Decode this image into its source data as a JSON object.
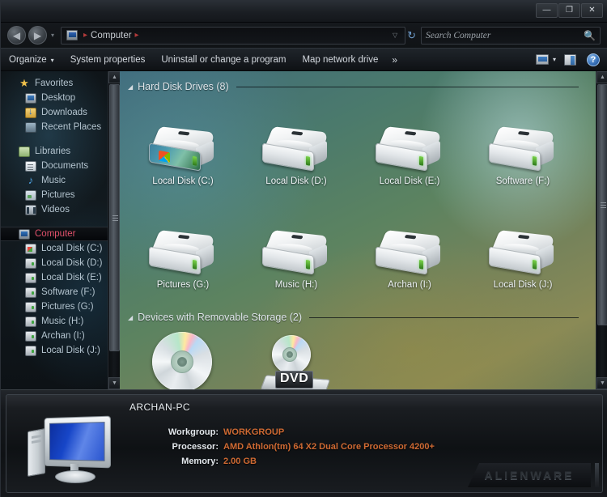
{
  "window": {
    "minimize_label": "—",
    "restore_label": "❐",
    "close_label": "✕"
  },
  "address_bar": {
    "back_label": "◀",
    "forward_label": "▶",
    "history_caret": "▾",
    "crumb_text": "Computer",
    "crumb_sep": "▸",
    "dropdown_caret": "▽",
    "refresh_label": "↻"
  },
  "search": {
    "placeholder": "Search Computer",
    "value": "",
    "icon_label": "🔍"
  },
  "command_bar": {
    "items": [
      {
        "label": "Organize",
        "caret": "▾"
      },
      {
        "label": "System properties",
        "caret": ""
      },
      {
        "label": "Uninstall or change a program",
        "caret": ""
      },
      {
        "label": "Map network drive",
        "caret": ""
      }
    ],
    "overflow_label": "»",
    "view_caret": "▾",
    "help_label": "?"
  },
  "sidebar": {
    "groups": [
      {
        "header": {
          "label": "Favorites",
          "icon": "star-icon",
          "icon_class": "ic-star",
          "glyph": "★"
        },
        "items": [
          {
            "label": "Desktop",
            "icon": "desktop-icon",
            "icon_class": "ic-desktop"
          },
          {
            "label": "Downloads",
            "icon": "downloads-icon",
            "icon_class": "ic-download"
          },
          {
            "label": "Recent Places",
            "icon": "recent-places-icon",
            "icon_class": "ic-recent"
          }
        ]
      },
      {
        "header": {
          "label": "Libraries",
          "icon": "libraries-icon",
          "icon_class": "ic-lib",
          "glyph": ""
        },
        "items": [
          {
            "label": "Documents",
            "icon": "documents-icon",
            "icon_class": "ic-doc"
          },
          {
            "label": "Music",
            "icon": "music-icon",
            "icon_class": "ic-music"
          },
          {
            "label": "Pictures",
            "icon": "pictures-icon",
            "icon_class": "ic-pic"
          },
          {
            "label": "Videos",
            "icon": "videos-icon",
            "icon_class": "ic-vid"
          }
        ]
      },
      {
        "header": {
          "label": "Computer",
          "icon": "computer-icon",
          "icon_class": "ic-comp",
          "glyph": "",
          "selected": true
        },
        "items": [
          {
            "label": "Local Disk (C:)",
            "icon": "drive-icon",
            "icon_class": "ic-drive-win"
          },
          {
            "label": "Local Disk (D:)",
            "icon": "drive-icon",
            "icon_class": "ic-drive"
          },
          {
            "label": "Local Disk (E:)",
            "icon": "drive-icon",
            "icon_class": "ic-drive"
          },
          {
            "label": "Software (F:)",
            "icon": "drive-icon",
            "icon_class": "ic-drive"
          },
          {
            "label": "Pictures (G:)",
            "icon": "drive-icon",
            "icon_class": "ic-drive"
          },
          {
            "label": "Music (H:)",
            "icon": "drive-icon",
            "icon_class": "ic-drive"
          },
          {
            "label": "Archan (I:)",
            "icon": "drive-icon",
            "icon_class": "ic-drive"
          },
          {
            "label": "Local Disk (J:)",
            "icon": "drive-icon",
            "icon_class": "ic-drive"
          }
        ]
      }
    ],
    "selected_label": "Computer"
  },
  "content": {
    "groups": [
      {
        "label": "Hard Disk Drives (8)",
        "caret": "◢"
      },
      {
        "label": "Devices with Removable Storage (2)",
        "caret": "◢"
      }
    ],
    "hard_drives": [
      {
        "label": "Local Disk (C:)",
        "system": true
      },
      {
        "label": "Local Disk (D:)",
        "system": false
      },
      {
        "label": "Local Disk (E:)",
        "system": false
      },
      {
        "label": "Software (F:)",
        "system": false
      },
      {
        "label": "Pictures (G:)",
        "system": false
      },
      {
        "label": "Music (H:)",
        "system": false
      },
      {
        "label": "Archan (I:)",
        "system": false
      },
      {
        "label": "Local Disk (J:)",
        "system": false
      }
    ],
    "removable": [
      {
        "label": "",
        "badge": ""
      },
      {
        "label": "",
        "badge": "DVD"
      }
    ]
  },
  "details": {
    "pc_name": "ARCHAN-PC",
    "rows": [
      {
        "key": "Workgroup:",
        "value": "WORKGROUP"
      },
      {
        "key": "Processor:",
        "value": "AMD Athlon(tm) 64 X2 Dual Core Processor 4200+"
      },
      {
        "key": "Memory:",
        "value": "2.00 GB"
      }
    ],
    "brand": "ALIENWARE"
  },
  "colors": {
    "accent_value": "#cf6a33",
    "selected_sidebar": "#e0506a",
    "crumb_separator": "#b03a3a"
  }
}
